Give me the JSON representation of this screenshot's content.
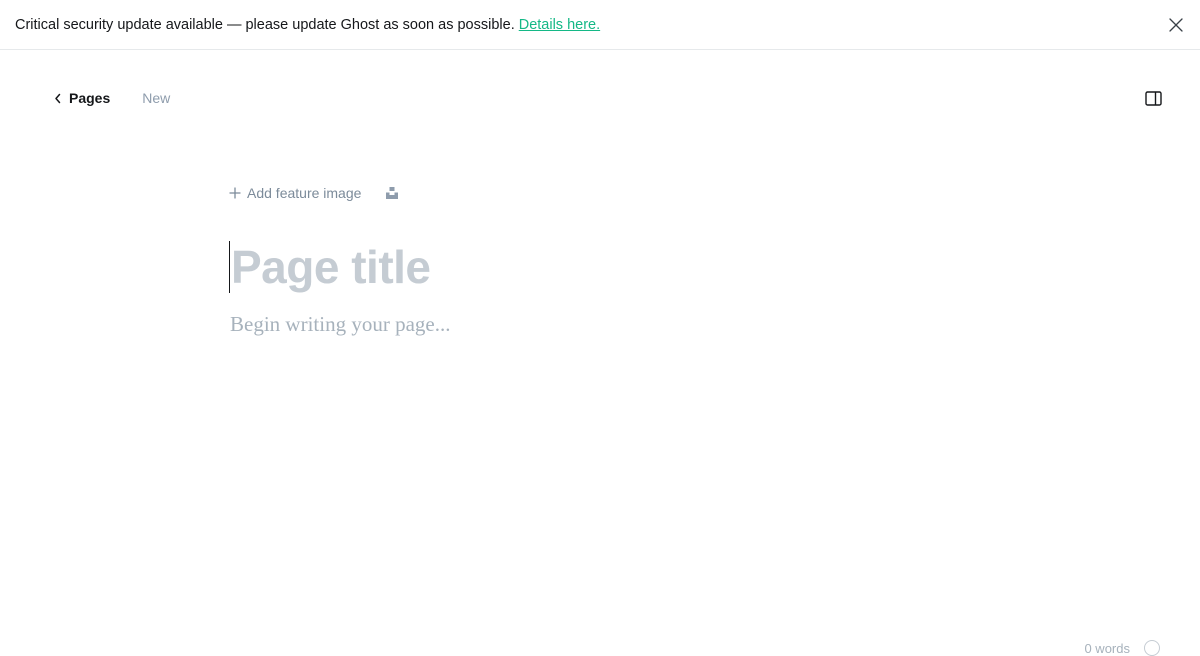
{
  "banner": {
    "message": "Critical security update available — please update Ghost as soon as possible.",
    "link_label": "Details here.",
    "close_icon": "close-icon"
  },
  "nav": {
    "back_label": "Pages",
    "status": "New"
  },
  "editor": {
    "add_feature_image_label": "Add feature image",
    "title_placeholder": "Page title",
    "body_placeholder": "Begin writing your page..."
  },
  "footer": {
    "word_count_partial": "0 words"
  },
  "colors": {
    "link": "#14b886",
    "placeholder": "#c5ccd3",
    "muted": "#8e9cac"
  }
}
